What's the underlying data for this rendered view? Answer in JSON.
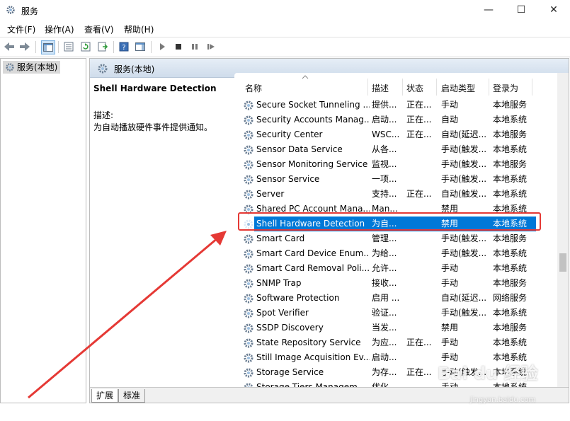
{
  "window": {
    "title": "服务",
    "minimize": "—",
    "maximize": "☐",
    "close": "✕"
  },
  "menu": [
    "文件(F)",
    "操作(A)",
    "查看(V)",
    "帮助(H)"
  ],
  "tree": {
    "root_label": "服务(本地)"
  },
  "pane": {
    "header": "服务(本地)",
    "selected_title": "Shell Hardware Detection",
    "desc_label": "描述:",
    "desc_text": "为自动播放硬件事件提供通知。"
  },
  "columns": [
    "名称",
    "描述",
    "状态",
    "启动类型",
    "登录为"
  ],
  "services": [
    {
      "name": "Secure Socket Tunneling ...",
      "desc": "提供...",
      "status": "正在...",
      "startup": "手动",
      "logon": "本地服务"
    },
    {
      "name": "Security Accounts Manag...",
      "desc": "启动...",
      "status": "正在...",
      "startup": "自动",
      "logon": "本地系统"
    },
    {
      "name": "Security Center",
      "desc": "WSC...",
      "status": "正在...",
      "startup": "自动(延迟...",
      "logon": "本地服务"
    },
    {
      "name": "Sensor Data Service",
      "desc": "从各...",
      "status": "",
      "startup": "手动(触发...",
      "logon": "本地系统"
    },
    {
      "name": "Sensor Monitoring Service",
      "desc": "监视...",
      "status": "",
      "startup": "手动(触发...",
      "logon": "本地服务"
    },
    {
      "name": "Sensor Service",
      "desc": "一项...",
      "status": "",
      "startup": "手动(触发...",
      "logon": "本地系统"
    },
    {
      "name": "Server",
      "desc": "支持...",
      "status": "正在...",
      "startup": "自动(触发...",
      "logon": "本地系统"
    },
    {
      "name": "Shared PC Account Mana...",
      "desc": "Man...",
      "status": "",
      "startup": "禁用",
      "logon": "本地系统"
    },
    {
      "name": "Shell Hardware Detection",
      "desc": "为自...",
      "status": "",
      "startup": "禁用",
      "logon": "本地系统",
      "selected": true
    },
    {
      "name": "Smart Card",
      "desc": "管理...",
      "status": "",
      "startup": "手动(触发...",
      "logon": "本地服务"
    },
    {
      "name": "Smart Card Device Enum...",
      "desc": "为给...",
      "status": "",
      "startup": "手动(触发...",
      "logon": "本地系统"
    },
    {
      "name": "Smart Card Removal Poli...",
      "desc": "允许...",
      "status": "",
      "startup": "手动",
      "logon": "本地系统"
    },
    {
      "name": "SNMP Trap",
      "desc": "接收...",
      "status": "",
      "startup": "手动",
      "logon": "本地服务"
    },
    {
      "name": "Software Protection",
      "desc": "启用 ...",
      "status": "",
      "startup": "自动(延迟...",
      "logon": "网络服务"
    },
    {
      "name": "Spot Verifier",
      "desc": "验证...",
      "status": "",
      "startup": "手动(触发...",
      "logon": "本地系统"
    },
    {
      "name": "SSDP Discovery",
      "desc": "当发...",
      "status": "",
      "startup": "禁用",
      "logon": "本地服务"
    },
    {
      "name": "State Repository Service",
      "desc": "为应...",
      "status": "正在...",
      "startup": "手动",
      "logon": "本地系统"
    },
    {
      "name": "Still Image Acquisition Ev...",
      "desc": "启动...",
      "status": "",
      "startup": "手动",
      "logon": "本地系统"
    },
    {
      "name": "Storage Service",
      "desc": "为存...",
      "status": "正在...",
      "startup": "手动(触发...",
      "logon": "本地系统"
    },
    {
      "name": "Storage Tiers Managem...",
      "desc": "优化...",
      "status": "",
      "startup": "手动",
      "logon": "本地系统"
    }
  ],
  "tabs": [
    "扩展",
    "标准"
  ],
  "watermark": {
    "brand": "Bai du 经验",
    "url": "jingyan.baidu.com"
  },
  "colors": {
    "selection": "#0078d7",
    "highlight_box": "#e53935",
    "arrow": "#e53935"
  }
}
